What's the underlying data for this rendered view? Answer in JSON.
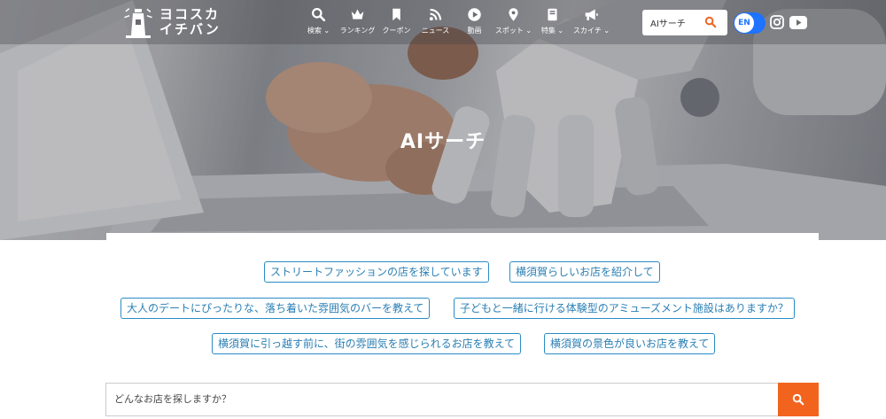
{
  "brand": {
    "logo_line1": "ヨコスカ",
    "logo_line2": "イチバン"
  },
  "nav": [
    {
      "label": "検索",
      "has_dropdown": true,
      "icon": "search-icon"
    },
    {
      "label": "ランキング",
      "has_dropdown": false,
      "icon": "crown-icon"
    },
    {
      "label": "クーポン",
      "has_dropdown": false,
      "icon": "bookmark-icon"
    },
    {
      "label": "ニュース",
      "has_dropdown": false,
      "icon": "rss-icon"
    },
    {
      "label": "動画",
      "has_dropdown": false,
      "icon": "play-icon"
    },
    {
      "label": "スポット",
      "has_dropdown": true,
      "icon": "map-pin-icon"
    },
    {
      "label": "特集",
      "has_dropdown": true,
      "icon": "book-icon"
    },
    {
      "label": "スカイチ",
      "has_dropdown": true,
      "icon": "megaphone-icon"
    }
  ],
  "header": {
    "search_label": "AIサーチ",
    "lang_label": "EN"
  },
  "hero": {
    "title": "AIサーチ"
  },
  "suggestions": [
    "ストリートファッションの店を探しています",
    "横須賀らしいお店を紹介して",
    "大人のデートにぴったりな、落ち着いた雰囲気のバーを教えて",
    "子どもと一緒に行ける体験型のアミューズメント施設はありますか？",
    "横須賀に引っ越す前に、街の雰囲気を感じられるお店を教えて",
    "横須賀の景色が良いお店を教えて"
  ],
  "query": {
    "placeholder": "どんなお店を探しますか？"
  },
  "colors": {
    "accent": "#f2641e",
    "chip_border": "#2a8cc4",
    "lang_toggle": "#1e73ff"
  }
}
